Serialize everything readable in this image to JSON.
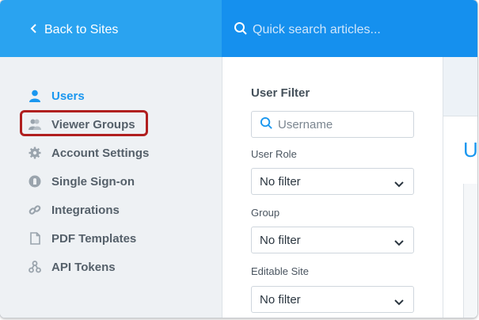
{
  "header": {
    "back_label": "Back to Sites",
    "search_placeholder": "Quick search articles..."
  },
  "sidebar": {
    "items": [
      {
        "label": "Users",
        "icon": "user-icon",
        "active": true
      },
      {
        "label": "Viewer Groups",
        "icon": "viewer-groups-icon",
        "active": false
      },
      {
        "label": "Account Settings",
        "icon": "gear-icon",
        "active": false
      },
      {
        "label": "Single Sign-on",
        "icon": "lock-icon",
        "active": false
      },
      {
        "label": "Integrations",
        "icon": "link-icon",
        "active": false
      },
      {
        "label": "PDF Templates",
        "icon": "document-icon",
        "active": false
      },
      {
        "label": "API Tokens",
        "icon": "api-tokens-icon",
        "active": false
      }
    ]
  },
  "filter": {
    "title": "User Filter",
    "search_placeholder": "Username",
    "user_role": {
      "label": "User Role",
      "value": "No filter"
    },
    "group": {
      "label": "Group",
      "value": "No filter"
    },
    "editable_site": {
      "label": "Editable Site",
      "value": "No filter"
    }
  },
  "content": {
    "heading_partial": "U"
  },
  "colors": {
    "header_left": "#2aa3f0",
    "header_right": "#1590ee",
    "accent": "#1a97ef",
    "highlight": "#b01f1f"
  }
}
